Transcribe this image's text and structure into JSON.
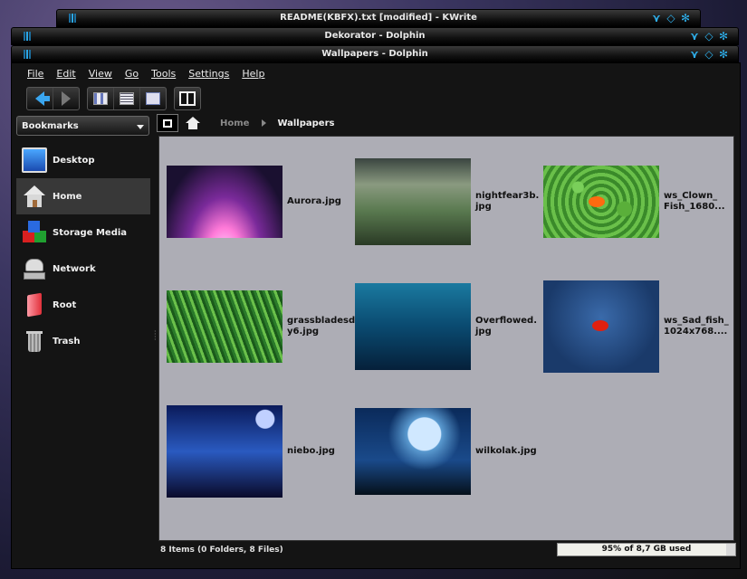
{
  "windows": {
    "back1_title": "README(KBFX).txt [modified] - KWrite",
    "back2_title": "Dekorator - Dolphin",
    "main_title": "Wallpapers - Dolphin"
  },
  "titlebar_buttons": [
    "minimize-icon",
    "maximize-icon",
    "close-icon"
  ],
  "menubar": [
    "File",
    "Edit",
    "View",
    "Go",
    "Tools",
    "Settings",
    "Help"
  ],
  "toolbar": {
    "buttons": [
      "back-icon",
      "forward-icon",
      "icons-view-icon",
      "details-view-icon",
      "preview-icon",
      "split-view-icon"
    ]
  },
  "sidebar": {
    "selector_label": "Bookmarks",
    "items": [
      {
        "label": "Desktop",
        "icon": "desktop-icon"
      },
      {
        "label": "Home",
        "icon": "home-icon",
        "selected": true
      },
      {
        "label": "Storage Media",
        "icon": "storage-media-icon"
      },
      {
        "label": "Network",
        "icon": "network-icon"
      },
      {
        "label": "Root",
        "icon": "root-folder-icon"
      },
      {
        "label": "Trash",
        "icon": "trash-icon"
      }
    ]
  },
  "breadcrumb": {
    "home": "Home",
    "current": "Wallpapers"
  },
  "files": [
    {
      "name": "Aurora.jpg"
    },
    {
      "name": "nightfear3b.\njpg"
    },
    {
      "name": "ws_Clown_\nFish_1680..."
    },
    {
      "name": "grassbladesd\ny6.jpg"
    },
    {
      "name": "Overflowed.\njpg"
    },
    {
      "name": "ws_Sad_fish_\n1024x768...."
    },
    {
      "name": "niebo.jpg"
    },
    {
      "name": "wilkolak.jpg"
    }
  ],
  "status": {
    "text": "8 Items (0 Folders, 8 Files)",
    "capacity_label": "95% of 8,7 GB used",
    "capacity_fraction": 0.95
  },
  "colors": {
    "accent": "#2eaeea",
    "content_bg": "#adadb5",
    "window_bg": "#141414"
  }
}
